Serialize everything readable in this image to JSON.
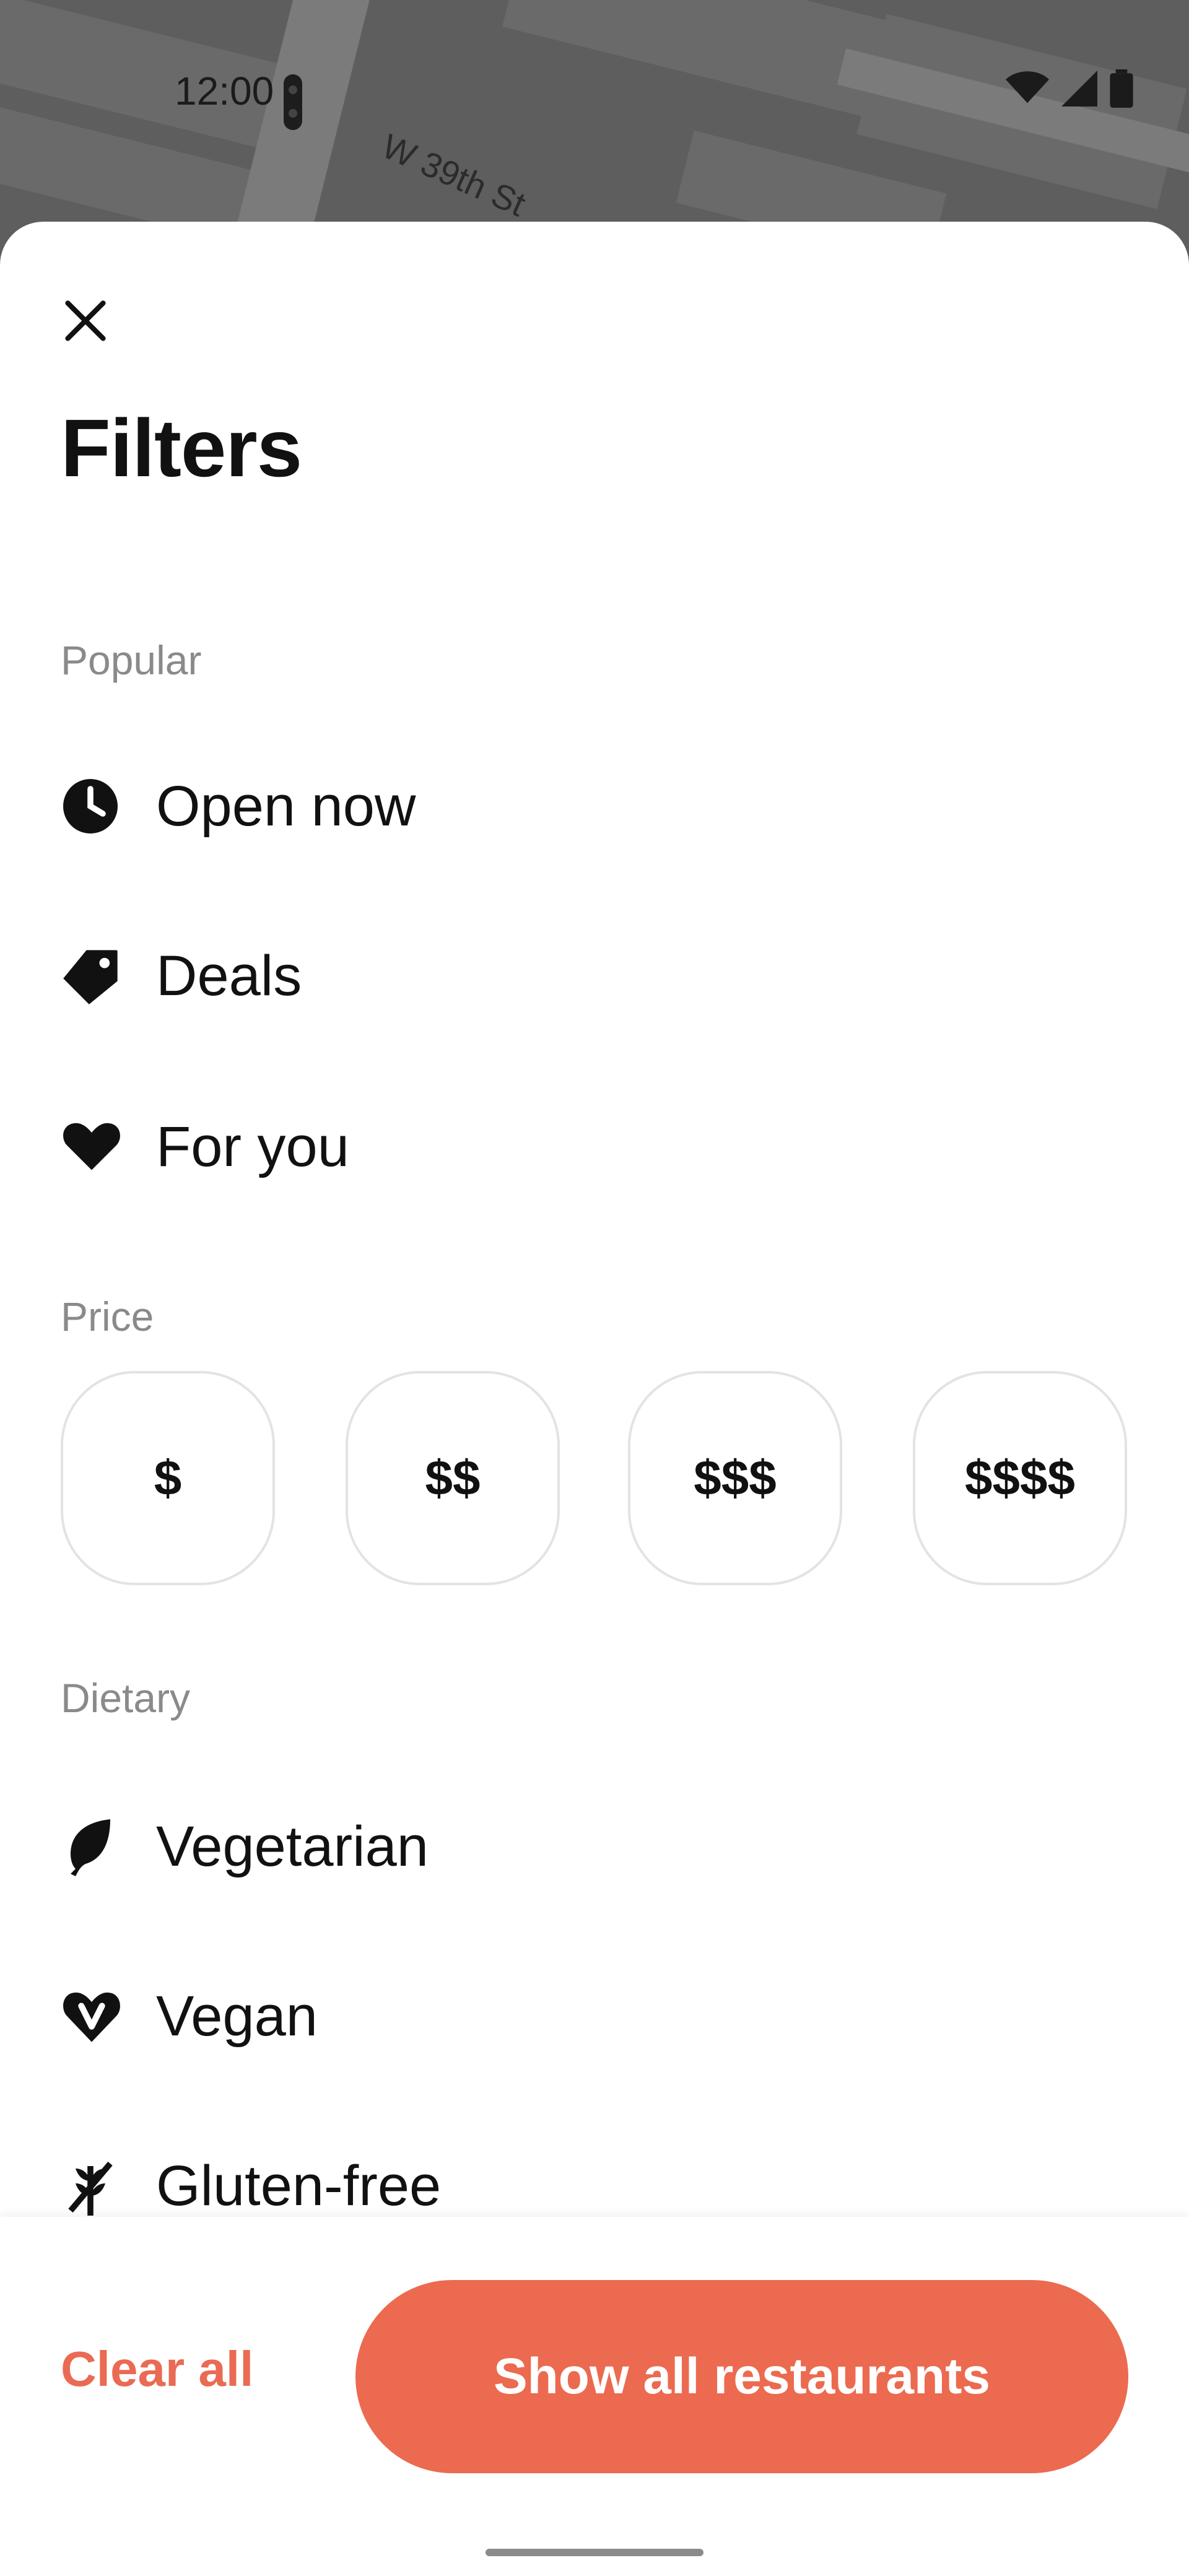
{
  "status_bar": {
    "time": "12:00"
  },
  "map": {
    "street_label": "W 39th St"
  },
  "sheet": {
    "title": "Filters",
    "sections": {
      "popular": {
        "label": "Popular",
        "items": [
          {
            "label": "Open now",
            "icon": "clock-icon"
          },
          {
            "label": "Deals",
            "icon": "tag-icon"
          },
          {
            "label": "For you",
            "icon": "heart-icon"
          }
        ]
      },
      "price": {
        "label": "Price",
        "options": [
          "$",
          "$$",
          "$$$",
          "$$$$"
        ]
      },
      "dietary": {
        "label": "Dietary",
        "items": [
          {
            "label": "Vegetarian",
            "icon": "leaf-icon"
          },
          {
            "label": "Vegan",
            "icon": "vegan-heart-icon"
          },
          {
            "label": "Gluten-free",
            "icon": "gluten-free-icon"
          }
        ]
      }
    }
  },
  "actions": {
    "clear_all": "Clear all",
    "show_all": "Show all restaurants"
  },
  "colors": {
    "accent": "#ec6a4f",
    "section_label": "#8a8a8a"
  }
}
